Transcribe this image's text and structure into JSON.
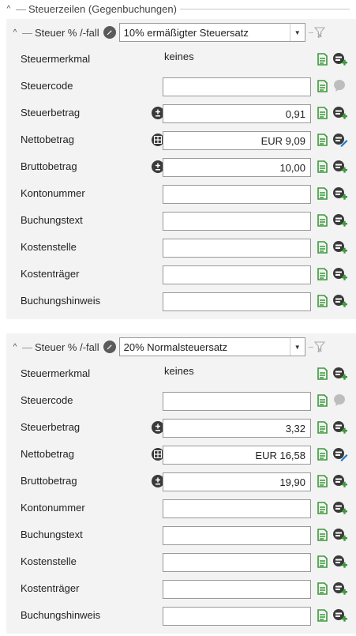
{
  "section": {
    "title": "Steuerzeilen (Gegenbuchungen)"
  },
  "panels": [
    {
      "header_label": "Steuer % /-fall",
      "rate_value": "10% ermäßigter Steuersatz",
      "rows": {
        "steuermerkmal": {
          "label": "Steuermerkmal",
          "value": "keines"
        },
        "steuercode": {
          "label": "Steuercode",
          "value": ""
        },
        "steuerbetrag": {
          "label": "Steuerbetrag",
          "value": "0,91"
        },
        "nettobetrag": {
          "label": "Nettobetrag",
          "value": "EUR 9,09"
        },
        "bruttobetrag": {
          "label": "Bruttobetrag",
          "value": "10,00"
        },
        "kontonummer": {
          "label": "Kontonummer",
          "value": ""
        },
        "buchungstext": {
          "label": "Buchungstext",
          "value": ""
        },
        "kostenstelle": {
          "label": "Kostenstelle",
          "value": ""
        },
        "kostentraeger": {
          "label": "Kostenträger",
          "value": ""
        },
        "buchungshinweis": {
          "label": "Buchungshinweis",
          "value": ""
        }
      }
    },
    {
      "header_label": "Steuer % /-fall",
      "rate_value": "20% Normalsteuersatz",
      "rows": {
        "steuermerkmal": {
          "label": "Steuermerkmal",
          "value": "keines"
        },
        "steuercode": {
          "label": "Steuercode",
          "value": ""
        },
        "steuerbetrag": {
          "label": "Steuerbetrag",
          "value": "3,32"
        },
        "nettobetrag": {
          "label": "Nettobetrag",
          "value": "EUR 16,58"
        },
        "bruttobetrag": {
          "label": "Bruttobetrag",
          "value": "19,90"
        },
        "kontonummer": {
          "label": "Kontonummer",
          "value": ""
        },
        "buchungstext": {
          "label": "Buchungstext",
          "value": ""
        },
        "kostenstelle": {
          "label": "Kostenstelle",
          "value": ""
        },
        "kostentraeger": {
          "label": "Kostenträger",
          "value": ""
        },
        "buchungshinweis": {
          "label": "Buchungshinweis",
          "value": ""
        }
      }
    }
  ],
  "icons": {
    "collapse": "caret-up-icon",
    "edit": "pencil-icon",
    "dropdown": "chevron-down-icon",
    "filter": "filter-clear-icon",
    "document": "document-lines-icon",
    "account": "account-add-icon",
    "plus_minus": "plus-minus-icon",
    "calculator": "calculator-icon",
    "comment": "comment-icon"
  },
  "colors": {
    "green": "#3a9a3a",
    "dark": "#3a3a3a",
    "blue": "#1e78c8",
    "panel_bg": "#f3f3f3"
  }
}
